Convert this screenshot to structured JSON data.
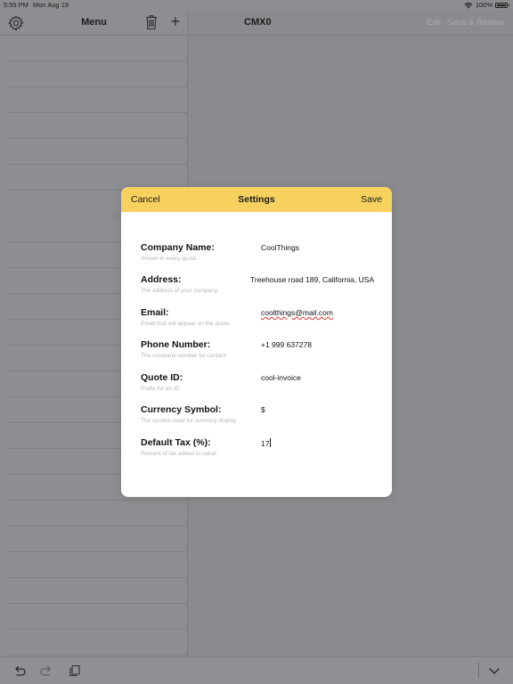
{
  "status_bar": {
    "time": "5:55 PM",
    "date": "Mon Aug 19",
    "battery": "100%"
  },
  "left_nav": {
    "title": "Menu"
  },
  "right_nav": {
    "title": "CMX0",
    "edit": "Edit",
    "save_review": "Save & Review"
  },
  "modal": {
    "cancel": "Cancel",
    "title": "Settings",
    "save": "Save",
    "fields": [
      {
        "label": "Company Name:",
        "hint": "Shown in every quote.",
        "value": "CoolThings"
      },
      {
        "label": "Address:",
        "hint": "The address of your company.",
        "value": "Treehouse road 189, California, USA"
      },
      {
        "label": "Email:",
        "hint": "Email that will appear on the quote",
        "value": "coolthings@mail.com"
      },
      {
        "label": "Phone Number:",
        "hint": "The company number for contact",
        "value": "+1 999 637278"
      },
      {
        "label": "Quote ID:",
        "hint": "Prefix for an ID.",
        "value": "cool-invoice"
      },
      {
        "label": "Currency Symbol:",
        "hint": "The symbol used for currency display",
        "value": "$"
      },
      {
        "label": "Default Tax (%):",
        "hint": "Percent of tax added to value.",
        "value": "17"
      }
    ]
  },
  "icons": {
    "settings": "gear-icon",
    "delete": "trash-icon",
    "add": "plus-icon",
    "undo": "undo-icon",
    "redo": "redo-icon",
    "paste": "paste-icon",
    "dismiss_keyboard": "chevron-down-icon",
    "wifi": "wifi-icon",
    "battery": "battery-icon"
  },
  "colors": {
    "modal_header": "#f7d15e",
    "dimmed_background": "#8a8b8e",
    "hint_text": "#b6b6b8",
    "spellcheck": "#e0342f"
  }
}
